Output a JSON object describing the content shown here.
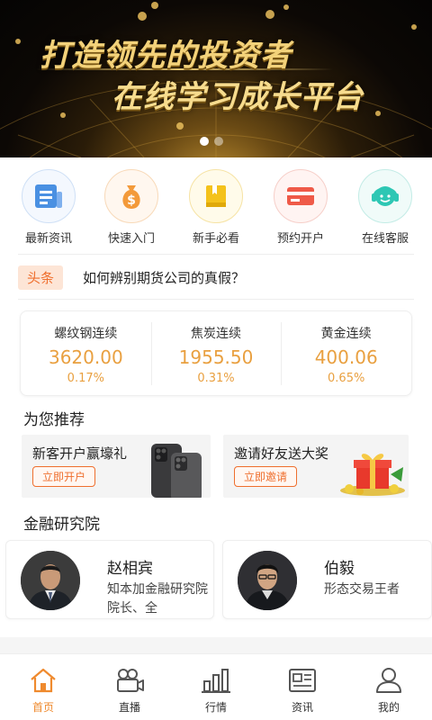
{
  "banner": {
    "line1": "打造领先的投资者",
    "line2": "在线学习成长平台",
    "slides": 2,
    "active_slide": 0
  },
  "quick_menu": [
    {
      "label": "最新资讯",
      "icon": "news-icon",
      "color": "#4a90e2"
    },
    {
      "label": "快速入门",
      "icon": "money-bag-icon",
      "color": "#f39a3a"
    },
    {
      "label": "新手必看",
      "icon": "book-icon",
      "color": "#f4c21b"
    },
    {
      "label": "预约开户",
      "icon": "card-icon",
      "color": "#ef5a48"
    },
    {
      "label": "在线客服",
      "icon": "headset-icon",
      "color": "#2ec7b4"
    }
  ],
  "headline": {
    "tag": "头条",
    "text": "如何辨别期货公司的真假？"
  },
  "quotes": [
    {
      "name": "螺纹钢连续",
      "value": "3620.00",
      "change": "0.17%"
    },
    {
      "name": "焦炭连续",
      "value": "1955.50",
      "change": "0.31%"
    },
    {
      "name": "黄金连续",
      "value": "400.06",
      "change": "0.65%"
    }
  ],
  "recommend": {
    "title": "为您推荐",
    "cards": [
      {
        "title": "新客开户赢壕礼",
        "button": "立即开户",
        "icon": "phone-icon"
      },
      {
        "title": "邀请好友送大奖",
        "button": "立即邀请",
        "icon": "gift-box-icon"
      }
    ]
  },
  "research": {
    "title": "金融研究院",
    "people": [
      {
        "name": "赵相宾",
        "desc": "知本加金融研究院院长、全"
      },
      {
        "name": "伯毅",
        "desc": "形态交易王者"
      }
    ]
  },
  "tabbar": [
    {
      "label": "首页",
      "icon": "home-icon",
      "active": true
    },
    {
      "label": "直播",
      "icon": "video-camera-icon",
      "active": false
    },
    {
      "label": "行情",
      "icon": "bar-chart-icon",
      "active": false
    },
    {
      "label": "资讯",
      "icon": "newspaper-icon",
      "active": false
    },
    {
      "label": "我的",
      "icon": "user-icon",
      "active": false
    }
  ],
  "colors": {
    "accent": "#ef8a2e",
    "quote_value": "#e9a040",
    "tag_bg": "#fde5d6"
  }
}
